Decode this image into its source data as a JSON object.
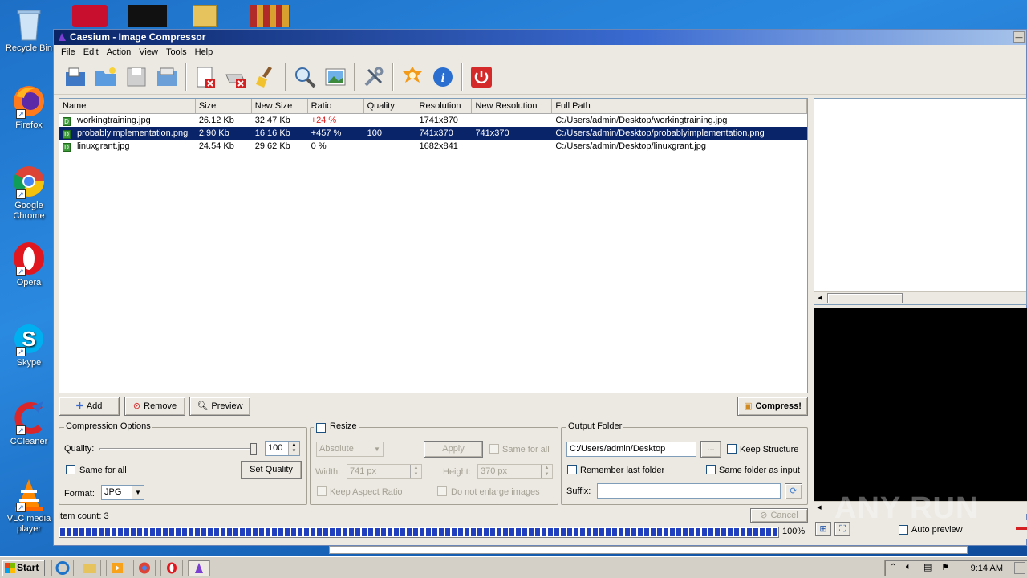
{
  "desktop": {
    "icons": [
      {
        "label": "Recycle Bin"
      },
      {
        "label": "Firefox"
      },
      {
        "label": "Google Chrome"
      },
      {
        "label": "Opera"
      },
      {
        "label": "Skype"
      },
      {
        "label": "CCleaner"
      },
      {
        "label": "VLC media player"
      }
    ]
  },
  "window": {
    "title": "Caesium - Image Compressor",
    "menu": [
      "File",
      "Edit",
      "Action",
      "View",
      "Tools",
      "Help"
    ]
  },
  "toolbar_icons": [
    "open-icon",
    "open-folder-icon",
    "save-icon",
    "save-list-icon",
    "remove-item-icon",
    "clear-list-icon",
    "clean-icon",
    "preview-icon",
    "image-icon",
    "settings-icon",
    "update-icon",
    "info-icon",
    "exit-icon"
  ],
  "table": {
    "headers": [
      "Name",
      "Size",
      "New Size",
      "Ratio",
      "Quality",
      "Resolution",
      "New Resolution",
      "Full Path"
    ],
    "rows": [
      {
        "name": "workingtraining.jpg",
        "size": "26.12 Kb",
        "new_size": "32.47 Kb",
        "ratio": "+24 %",
        "quality": "",
        "resolution": "1741x870",
        "new_resolution": "",
        "path": "C:/Users/admin/Desktop/workingtraining.jpg"
      },
      {
        "name": "probablyimplementation.png",
        "size": "2.90 Kb",
        "new_size": "16.16 Kb",
        "ratio": "+457 %",
        "quality": "100",
        "resolution": "741x370",
        "new_resolution": "741x370",
        "path": "C:/Users/admin/Desktop/probablyimplementation.png"
      },
      {
        "name": "linuxgrant.jpg",
        "size": "24.54 Kb",
        "new_size": "29.62 Kb",
        "ratio": "0 %",
        "quality": "",
        "resolution": "1682x841",
        "new_resolution": "",
        "path": "C:/Users/admin/Desktop/linuxgrant.jpg"
      }
    ]
  },
  "buttons": {
    "add": "Add",
    "remove": "Remove",
    "preview": "Preview",
    "compress": "Compress!",
    "cancel": "Cancel"
  },
  "compression": {
    "title": "Compression Options",
    "quality_label": "Quality:",
    "quality_value": "100",
    "quality_level": 1.0,
    "same_for_all": "Same for all",
    "set_quality": "Set Quality",
    "format_label": "Format:",
    "format_value": "JPG"
  },
  "resize": {
    "title": "Resize",
    "mode": "Absolute",
    "apply": "Apply",
    "same_for_all": "Same for all",
    "width_label": "Width:",
    "width_value": "741 px",
    "height_label": "Height:",
    "height_value": "370 px",
    "keep_aspect": "Keep Aspect Ratio",
    "no_enlarge": "Do not enlarge images"
  },
  "output": {
    "title": "Output Folder",
    "path": "C:/Users/admin/Desktop",
    "browse": "...",
    "keep_structure": "Keep Structure",
    "remember": "Remember last folder",
    "same_folder": "Same folder as input",
    "suffix_label": "Suffix:",
    "suffix_value": ""
  },
  "status": {
    "item_count": "Item count: 3",
    "progress_text": "100%",
    "progress": 1.0
  },
  "preview": {
    "auto_preview": "Auto preview"
  },
  "taskbar": {
    "start": "Start",
    "clock": "9:14 AM"
  },
  "watermark": "ANY RUN",
  "colors": {
    "selection": "#0a246a",
    "ratio_positive": "#e02020",
    "progress": "#1f3fbf"
  }
}
